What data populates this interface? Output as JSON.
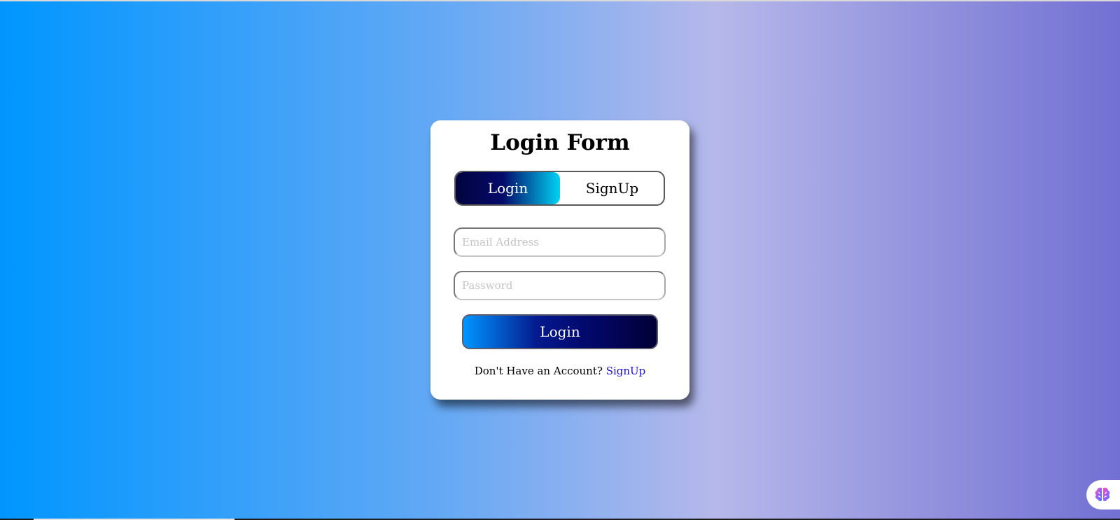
{
  "form": {
    "title": "Login Form",
    "tabs": [
      {
        "label": "Login",
        "active": true
      },
      {
        "label": "SignUp",
        "active": false
      }
    ],
    "email": {
      "placeholder": "Email Address",
      "value": ""
    },
    "password": {
      "placeholder": "Password",
      "value": ""
    },
    "submit_label": "Login",
    "footer_text": "Don't Have an Account?",
    "footer_link": "SignUp"
  },
  "widget": {
    "icon": "brain-icon"
  },
  "colors": {
    "background_start": "#0096ff",
    "background_end": "#7270d2",
    "link": "#1a0ed9",
    "active_tab_start": "#02043d",
    "active_tab_end": "#00d2f3"
  }
}
